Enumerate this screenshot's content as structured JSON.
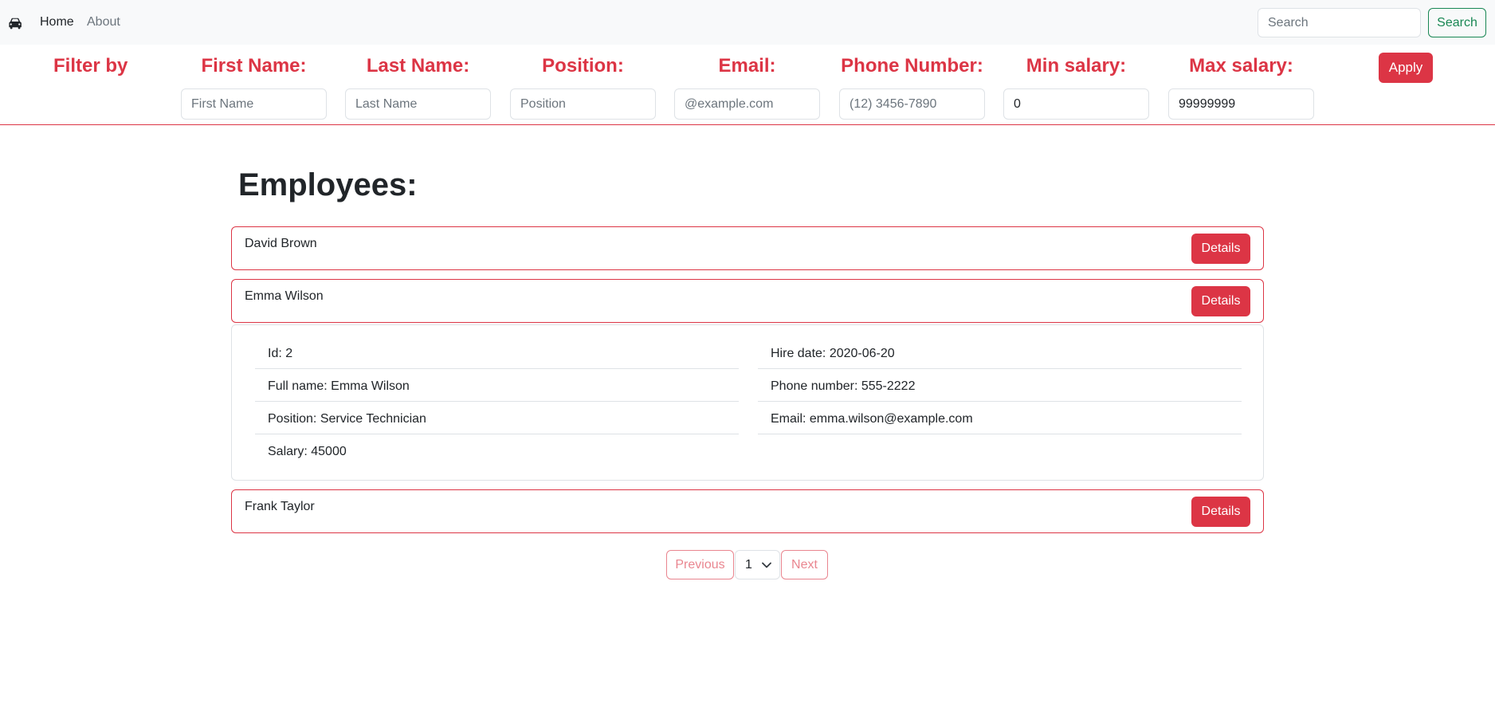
{
  "nav": {
    "brand_icon": "car-icon",
    "links": [
      "Home",
      "About"
    ],
    "search_placeholder": "Search",
    "search_button": "Search"
  },
  "filters": {
    "title": "Filter by",
    "fields": [
      {
        "label": "First Name:",
        "placeholder": "First Name",
        "value": ""
      },
      {
        "label": "Last Name:",
        "placeholder": "Last Name",
        "value": ""
      },
      {
        "label": "Position:",
        "placeholder": "Position",
        "value": ""
      },
      {
        "label": "Email:",
        "placeholder": "@example.com",
        "value": ""
      },
      {
        "label": "Phone Number:",
        "placeholder": "(12) 3456-7890",
        "value": ""
      },
      {
        "label": "Min salary:",
        "placeholder": "",
        "value": "0"
      },
      {
        "label": "Max salary:",
        "placeholder": "",
        "value": "99999999"
      }
    ],
    "apply": "Apply"
  },
  "main": {
    "title": "Employees:",
    "details_label": "Details",
    "employees": [
      {
        "name": "David Brown"
      },
      {
        "name": "Emma Wilson"
      },
      {
        "name": "Frank Taylor"
      }
    ],
    "details": {
      "left": [
        "Id: 2",
        "Full name: Emma Wilson",
        "Position: Service Technician",
        "Salary: 45000"
      ],
      "right": [
        "Hire date: 2020-06-20",
        "Phone number: 555-2222",
        "Email: emma.wilson@example.com"
      ]
    }
  },
  "pagination": {
    "previous": "Previous",
    "page": "1",
    "next": "Next"
  },
  "colors": {
    "accent": "#dc3545",
    "success": "#198754",
    "navbar_bg": "#f8f9fa",
    "border": "#dee2e6"
  }
}
